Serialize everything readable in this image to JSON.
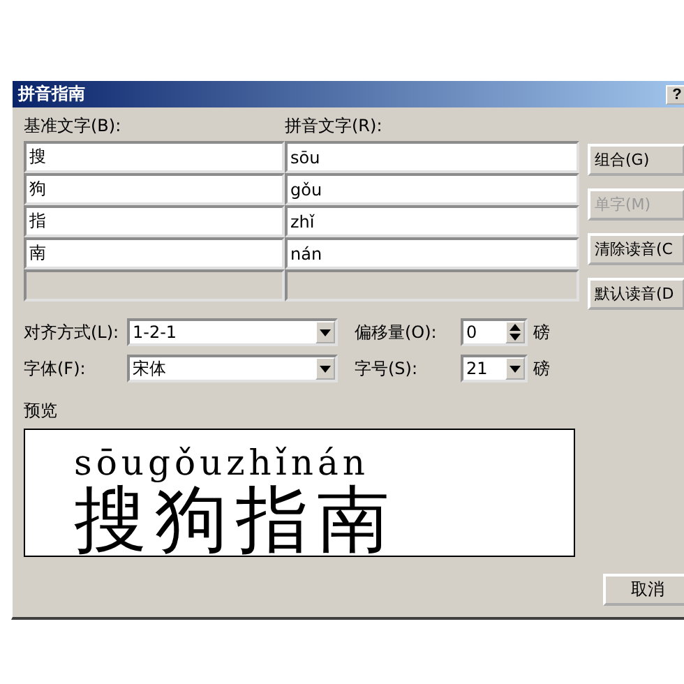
{
  "window": {
    "title": "拼音指南",
    "help_button": "?"
  },
  "columns": [
    "基准文字(B):",
    "拼音文字(R):"
  ],
  "rows": [
    {
      "base": "搜",
      "pinyin": "sōu"
    },
    {
      "base": "狗",
      "pinyin": "gǒu"
    },
    {
      "base": "指",
      "pinyin": "zhǐ"
    },
    {
      "base": "南",
      "pinyin": "nán"
    }
  ],
  "buttons": [
    {
      "label": "组合(G)",
      "disabled": false
    },
    {
      "label": "单字(M)",
      "disabled": true
    },
    {
      "label": "清除读音(C",
      "disabled": false
    },
    {
      "label": "默认读音(D",
      "disabled": false
    }
  ],
  "alignment": {
    "label": "对齐方式(L):",
    "value": "1-2-1"
  },
  "offset": {
    "label": "偏移量(O):",
    "value": "0",
    "unit": "磅"
  },
  "font": {
    "label": "字体(F):",
    "value": "宋体"
  },
  "size": {
    "label": "字号(S):",
    "value": "21",
    "unit": "磅"
  },
  "preview": {
    "label": "预览",
    "ruby": "sōugǒuzhǐnán",
    "text": "搜狗指南"
  },
  "footer_buttons": [
    "取消"
  ]
}
